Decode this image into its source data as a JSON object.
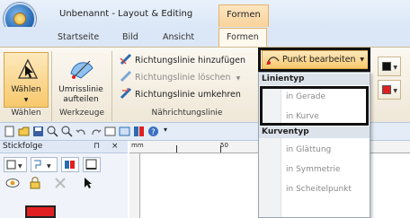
{
  "window": {
    "title": "Unbenannt - Layout & Editing",
    "context_tab": "Formen"
  },
  "tabs": [
    "Startseite",
    "Bild",
    "Ansicht",
    "Formen"
  ],
  "ribbon": {
    "group_labels": [
      "Wählen",
      "Werkzeuge",
      "Nährichtungslinie"
    ],
    "waehlen_button": "Wählen",
    "outline_button_line1": "Umrisslinie",
    "outline_button_line2": "aufteilen",
    "small_buttons": {
      "add_direction": "Richtungslinie hinzufügen",
      "delete_direction": "Richtungslinie löschen",
      "reverse_direction": "Richtungslinie umkehren"
    },
    "punkt_button": "Punkt bearbeiten"
  },
  "dropdown": {
    "section1": "Linientyp",
    "items1": [
      "in Gerade",
      "in Kurve"
    ],
    "section2": "Kurventyp",
    "items2": [
      "in Glättung",
      "in Symmetrie",
      "in Scheitelpunkt"
    ]
  },
  "panel": {
    "title": "Stickfolge",
    "pin": "⊓",
    "close": "×"
  },
  "ruler": {
    "mm_label": "mm",
    "tick_label": "50"
  },
  "colors": {
    "accent_orange": "#f7c86b",
    "window_blue": "#dbe7f6",
    "line_red": "#e02020"
  },
  "icons": {
    "app": "app-orb-icon",
    "select": "arrow-select-icon",
    "outline": "outline-split-icon",
    "add": "direction-add-icon",
    "delete": "direction-delete-icon",
    "reverse": "direction-reverse-icon",
    "punkt": "point-edit-icon"
  }
}
